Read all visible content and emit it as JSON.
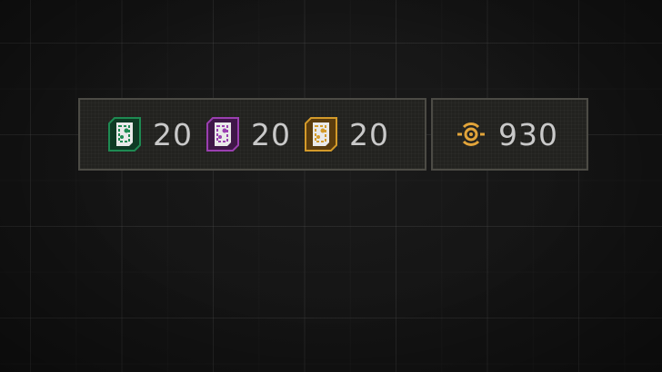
{
  "currencies": {
    "cards": [
      {
        "icon": "green-card-icon",
        "color": "#1e8a52",
        "count": "20"
      },
      {
        "icon": "purple-card-icon",
        "color": "#9a3fb0",
        "count": "20"
      },
      {
        "icon": "gold-card-icon",
        "color": "#d39a2a",
        "count": "20"
      }
    ],
    "coins": {
      "icon": "coin-icon",
      "color": "#e2a43a",
      "count": "930"
    }
  }
}
